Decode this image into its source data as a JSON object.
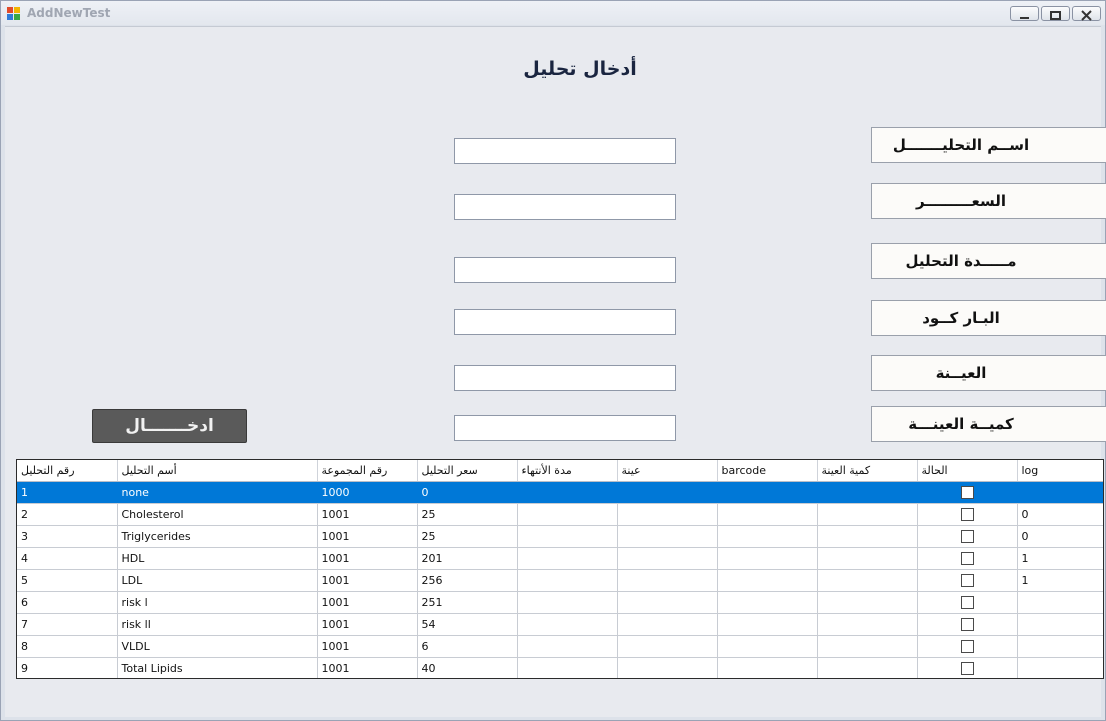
{
  "window": {
    "title": "AddNewTest",
    "minimize_glyph": "–",
    "maximize_glyph": "□",
    "close_glyph": "✕"
  },
  "form": {
    "heading": "أدخال تحليل",
    "labels": {
      "test_name": "اســم التحليـــــــل",
      "price": "السعـــــــــر",
      "duration": "مـــــدة التحليل",
      "barcode": "البـار كــود",
      "sample": "العيــنة",
      "sample_qty": "كميــة العينـــة"
    },
    "inputs": {
      "test_name": "",
      "price": "",
      "duration": "",
      "barcode": "",
      "sample": "",
      "sample_qty": ""
    },
    "submit_label": "ادخـــــــال"
  },
  "grid": {
    "columns": [
      "رقم التحليل",
      "أسم التحليل",
      "رقم المجموعة",
      "سعر التحليل",
      "مدة الأنتهاء",
      "عينة",
      "barcode",
      "كمية العينة",
      "الحالة",
      "log"
    ],
    "rows": [
      {
        "id": "1",
        "name": "none",
        "group": "1000",
        "price": "0",
        "end": "",
        "sample": "",
        "barcode": "",
        "qty": "",
        "log": "",
        "selected": true
      },
      {
        "id": "2",
        "name": "Cholesterol",
        "group": "1001",
        "price": "25",
        "end": "",
        "sample": "",
        "barcode": "",
        "qty": "",
        "log": "0"
      },
      {
        "id": "3",
        "name": "Triglycerides",
        "group": "1001",
        "price": "25",
        "end": "",
        "sample": "",
        "barcode": "",
        "qty": "",
        "log": "0"
      },
      {
        "id": "4",
        "name": "HDL",
        "group": "1001",
        "price": "201",
        "end": "",
        "sample": "",
        "barcode": "",
        "qty": "",
        "log": "1"
      },
      {
        "id": "5",
        "name": "LDL",
        "group": "1001",
        "price": "256",
        "end": "",
        "sample": "",
        "barcode": "",
        "qty": "",
        "log": "1"
      },
      {
        "id": "6",
        "name": "risk l",
        "group": "1001",
        "price": "251",
        "end": "",
        "sample": "",
        "barcode": "",
        "qty": "",
        "log": ""
      },
      {
        "id": "7",
        "name": "risk ll",
        "group": "1001",
        "price": "54",
        "end": "",
        "sample": "",
        "barcode": "",
        "qty": "",
        "log": ""
      },
      {
        "id": "8",
        "name": "VLDL",
        "group": "1001",
        "price": "6",
        "end": "",
        "sample": "",
        "barcode": "",
        "qty": "",
        "log": ""
      },
      {
        "id": "9",
        "name": "Total Lipids",
        "group": "1001",
        "price": "40",
        "end": "",
        "sample": "",
        "barcode": "",
        "qty": "",
        "log": ""
      }
    ]
  },
  "colors": {
    "selection": "#0078d7",
    "button_bg": "#5a5a5a"
  }
}
